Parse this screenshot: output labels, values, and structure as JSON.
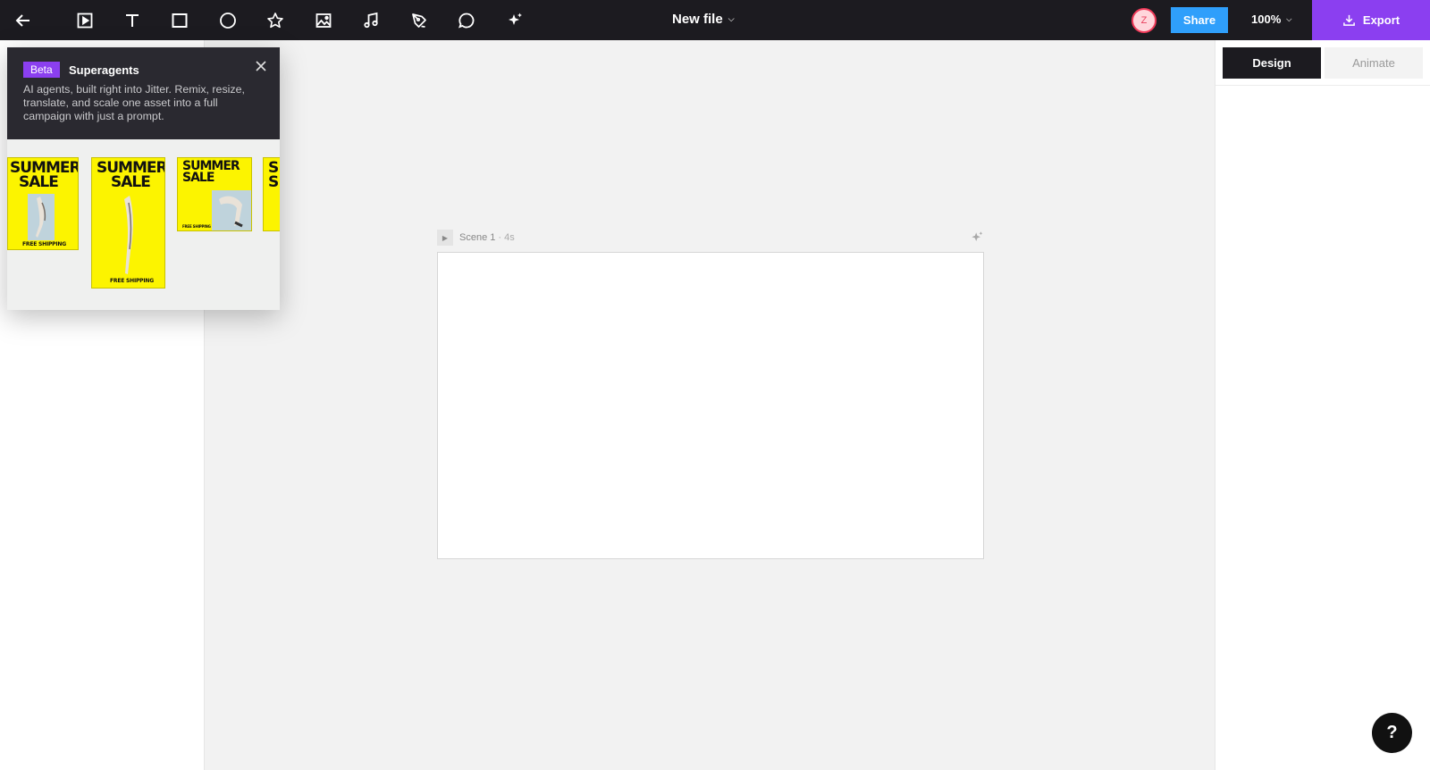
{
  "toolbar": {
    "back_icon": "arrow-left-icon",
    "tools": [
      "play-media-icon",
      "text-icon",
      "rectangle-icon",
      "ellipse-icon",
      "star-icon",
      "image-icon",
      "music-note-icon",
      "pen-icon",
      "comment-icon",
      "sparkle-icon"
    ],
    "file_name": "New file",
    "avatar_initial": "Z",
    "share_label": "Share",
    "zoom_label": "100%",
    "export_label": "Export"
  },
  "colors": {
    "topbar": "#1c1b20",
    "accent_purple": "#8b3ff0",
    "share_blue": "#2f9ffb",
    "canvas_bg": "#f2f2f2",
    "thumb_yellow": "#fcf400"
  },
  "right_panel": {
    "tabs": [
      {
        "label": "Design",
        "active": true
      },
      {
        "label": "Animate",
        "active": false
      }
    ]
  },
  "scene": {
    "name": "Scene 1",
    "separator": " · ",
    "duration": "4s"
  },
  "popup": {
    "badge": "Beta",
    "title": "Superagents",
    "description": "AI agents, built right into Jitter. Remix, resize, translate, and scale one asset into a full campaign with just a prompt.",
    "thumbnails": [
      {
        "headline": "SUMMER SALE",
        "line1": "SUMMER",
        "line2": "SALE",
        "footer": "FREE SHIPPING"
      },
      {
        "headline": "SUMMER SALE",
        "line1": "SUMMER",
        "line2": "SALE",
        "footer": "FREE SHIPPING"
      },
      {
        "headline": "SUMMER SALE",
        "line1": "SUMMER",
        "line2": "SALE",
        "footer": "FREE SHIPPING"
      },
      {
        "headline": "SUMMER SALE",
        "line1": "S",
        "line2": "S",
        "footer": ""
      }
    ]
  },
  "help": {
    "label": "?"
  }
}
